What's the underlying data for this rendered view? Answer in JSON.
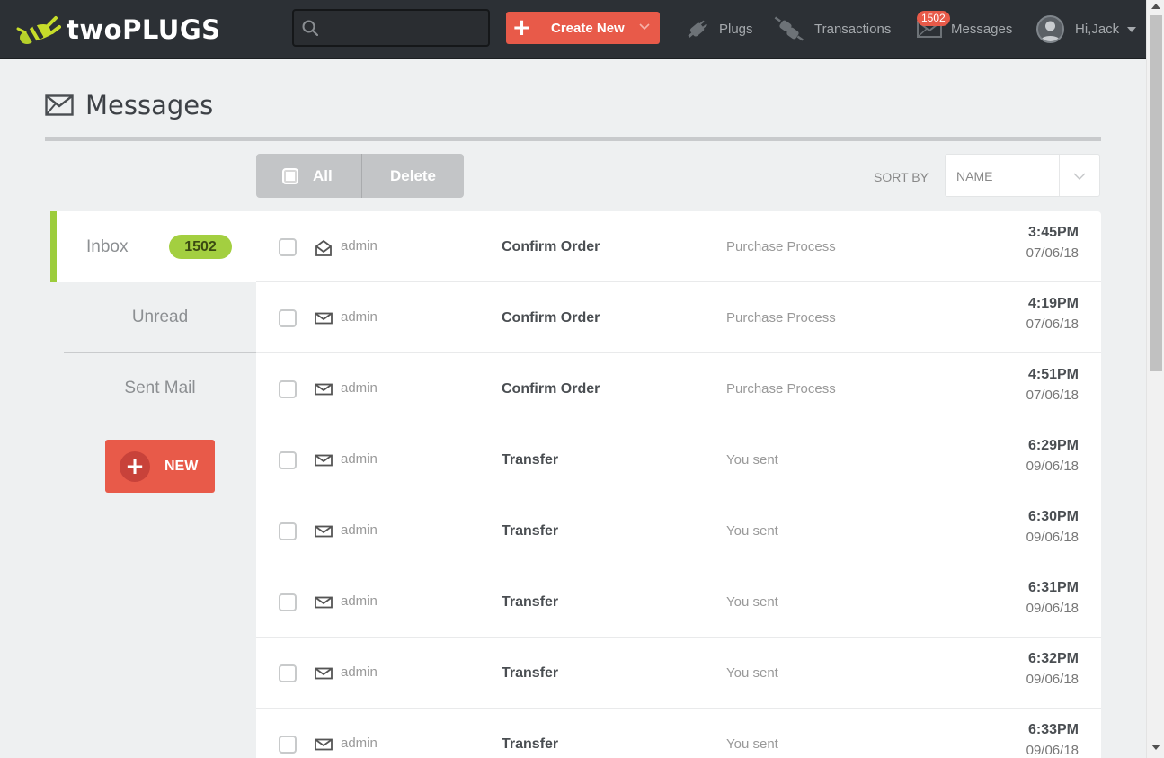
{
  "nav": {
    "brand": "twoPLUGS",
    "search": {
      "placeholder": "",
      "value": ""
    },
    "create_label": "Create New",
    "plugs_label": "Plugs",
    "transactions_label": "Transactions",
    "messages_label": "Messages",
    "messages_badge": "1502",
    "user_greeting": "Hi,Jack"
  },
  "page": {
    "title": "Messages"
  },
  "toolbar": {
    "all_label": "All",
    "delete_label": "Delete",
    "sort_by_label": "SORT BY",
    "sort_value": "NAME"
  },
  "folders": {
    "inbox_label": "Inbox",
    "inbox_count": "1502",
    "unread_label": "Unread",
    "sent_label": "Sent Mail",
    "new_label": "NEW"
  },
  "messages": [
    {
      "sender": "admin",
      "subject": "Confirm Order",
      "preview": "Purchase Process",
      "time": "3:45PM",
      "date": "07/06/18",
      "read": true
    },
    {
      "sender": "admin",
      "subject": "Confirm Order",
      "preview": "Purchase Process",
      "time": "4:19PM",
      "date": "07/06/18",
      "read": false
    },
    {
      "sender": "admin",
      "subject": "Confirm Order",
      "preview": "Purchase Process",
      "time": "4:51PM",
      "date": "07/06/18",
      "read": false
    },
    {
      "sender": "admin",
      "subject": "Transfer",
      "preview": "You sent",
      "time": "6:29PM",
      "date": "09/06/18",
      "read": false
    },
    {
      "sender": "admin",
      "subject": "Transfer",
      "preview": "You sent",
      "time": "6:30PM",
      "date": "09/06/18",
      "read": false
    },
    {
      "sender": "admin",
      "subject": "Transfer",
      "preview": "You sent",
      "time": "6:31PM",
      "date": "09/06/18",
      "read": false
    },
    {
      "sender": "admin",
      "subject": "Transfer",
      "preview": "You sent",
      "time": "6:32PM",
      "date": "09/06/18",
      "read": false
    },
    {
      "sender": "admin",
      "subject": "Transfer",
      "preview": "You sent",
      "time": "6:33PM",
      "date": "09/06/18",
      "read": false
    }
  ],
  "colors": {
    "nav_bg": "#2c3035",
    "accent_red": "#e85a49",
    "accent_green": "#a3cf40",
    "page_bg": "#eef0f1"
  },
  "icons": {
    "logo": "plug-logo-icon",
    "search": "search-icon",
    "create": "plus-icon",
    "plugs": "plug-icon",
    "transactions": "transactions-icon",
    "messages": "envelope-icon",
    "user": "avatar-icon"
  }
}
